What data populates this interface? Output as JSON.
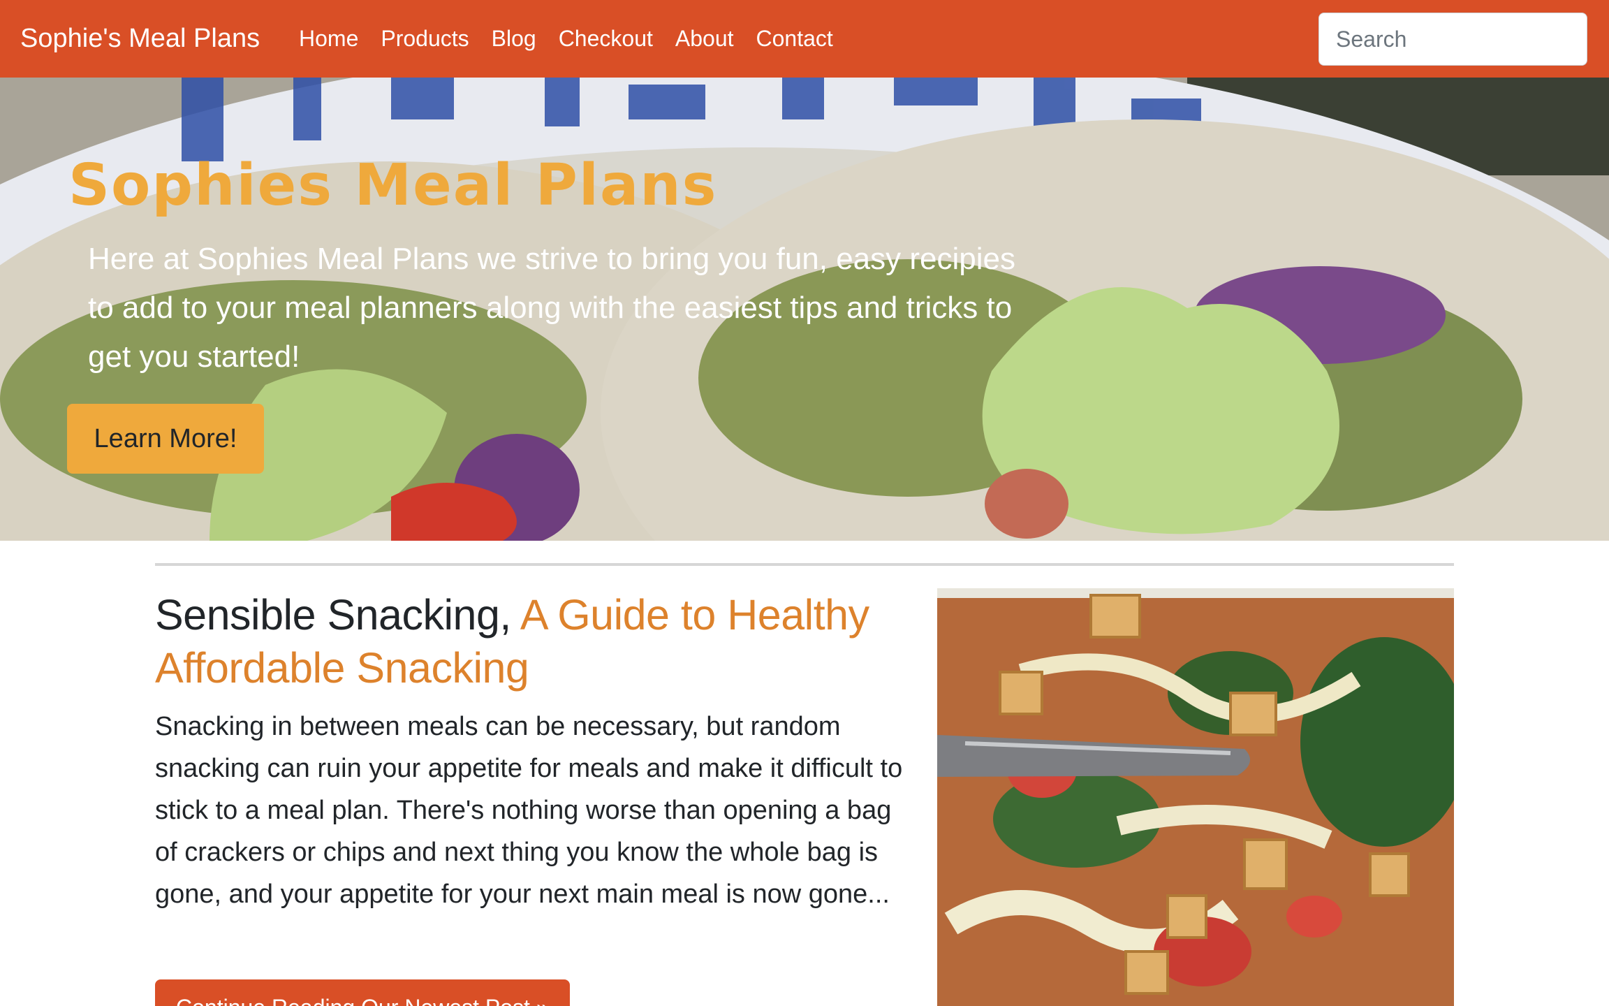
{
  "navbar": {
    "brand": "Sophie's Meal Plans",
    "links": [
      "Home",
      "Products",
      "Blog",
      "Checkout",
      "About",
      "Contact"
    ],
    "search_placeholder": "Search"
  },
  "hero": {
    "title": "Sophies Meal Plans",
    "text": "Here at Sophies Meal Plans we strive to bring you fun, easy recipies to add to your meal planners along with the easiest tips and tricks to get you started!",
    "button_label": "Learn More!"
  },
  "post": {
    "title_main": "Sensible Snacking,",
    "title_accent": "A Guide to Healthy Affordable Snacking",
    "body": "Snacking in between meals can be necessary, but random snacking can ruin your appetite for meals and make it difficult to stick to a meal plan. There's nothing worse than opening a bag of crackers or chips and next thing you know the whole bag is gone, and your appetite for your next main meal is now gone...",
    "button_label": "Continue Reading Our Newest Post »"
  },
  "colors": {
    "navbar": "#d94f26",
    "accent_gold": "#efa93c",
    "accent_orange": "#dd822c"
  }
}
